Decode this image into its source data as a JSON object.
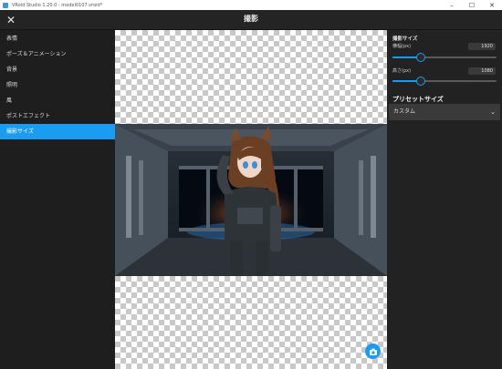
{
  "window": {
    "title": "VRoid Studio 1.20.0 - model0107.vroid*",
    "controls": [
      "–",
      "☐",
      "✕"
    ]
  },
  "header": {
    "close_icon": "close-icon",
    "title": "撮影"
  },
  "sidebar": {
    "items": [
      {
        "label": "表情",
        "active": false
      },
      {
        "label": "ポーズ＆アニメーション",
        "active": false
      },
      {
        "label": "背景",
        "active": false
      },
      {
        "label": "照明",
        "active": false
      },
      {
        "label": "風",
        "active": false
      },
      {
        "label": "ポストエフェクト",
        "active": false
      },
      {
        "label": "撮影サイズ",
        "active": true
      }
    ]
  },
  "panel": {
    "section_title": "撮影サイズ",
    "width": {
      "label": "横幅(px)",
      "value": "1920",
      "slider_fraction": 0.27
    },
    "height": {
      "label": "高さ(px)",
      "value": "1080",
      "slider_fraction": 0.27
    },
    "preset_title": "プリセットサイズ",
    "preset_value": "カスタム",
    "preset_icon": "chevron-down-icon"
  },
  "canvas": {
    "camera_icon": "camera-icon"
  },
  "colors": {
    "accent": "#1a9cf0",
    "background": "#1c1c1c"
  }
}
